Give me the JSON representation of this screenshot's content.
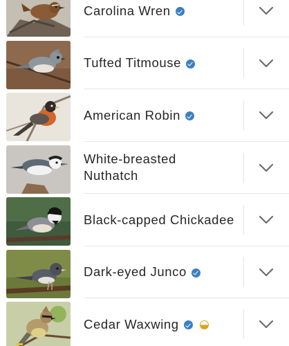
{
  "birds": [
    {
      "name": "Carolina Wren",
      "verified": true,
      "half_badge": false,
      "icon": "bird-photo-wren"
    },
    {
      "name": "Tufted Titmouse",
      "verified": true,
      "half_badge": false,
      "icon": "bird-photo-titmouse"
    },
    {
      "name": "American Robin",
      "verified": true,
      "half_badge": false,
      "icon": "bird-photo-robin"
    },
    {
      "name": "White-breasted Nuthatch",
      "line1": "White-breasted",
      "line2": "Nuthatch",
      "verified": false,
      "half_badge": false,
      "icon": "bird-photo-nuthatch"
    },
    {
      "name": "Black-capped Chickadee",
      "verified": false,
      "half_badge": false,
      "icon": "bird-photo-chickadee"
    },
    {
      "name": "Dark-eyed Junco",
      "verified": true,
      "half_badge": false,
      "icon": "bird-photo-junco"
    },
    {
      "name": "Cedar Waxwing",
      "verified": true,
      "half_badge": true,
      "icon": "bird-photo-waxwing"
    }
  ],
  "colors": {
    "verified_badge": "#3d7fc2",
    "half_badge": "#e0a21d",
    "chevron": "#6b6b6b",
    "text": "#262626"
  }
}
